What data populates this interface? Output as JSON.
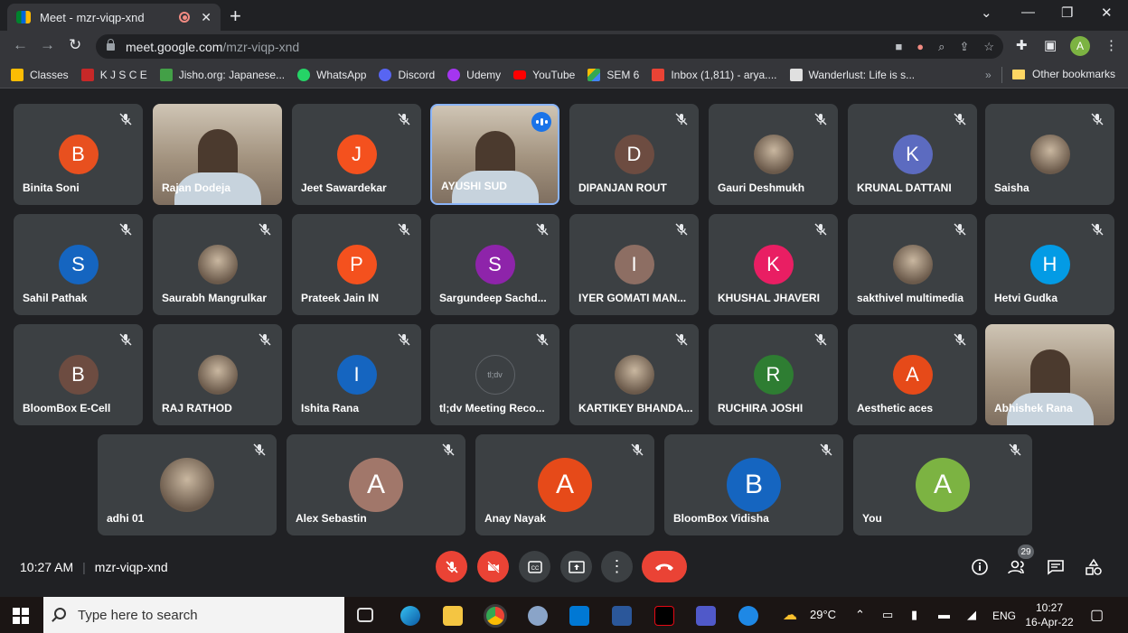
{
  "browser": {
    "tab_title": "Meet - mzr-viqp-xnd",
    "tab_close": "✕",
    "new_tab": "+",
    "url_host": "meet.google.com",
    "url_path": "/mzr-viqp-xnd",
    "profile_initial": "A"
  },
  "bookmarks": {
    "items": [
      "Classes",
      "K J S C E",
      "Jisho.org: Japanese...",
      "WhatsApp",
      "Discord",
      "Udemy",
      "YouTube",
      "SEM 6",
      "Inbox (1,811) - arya....",
      "Wanderlust: Life is s..."
    ],
    "more": "»",
    "other": "Other bookmarks"
  },
  "participants_row1": [
    {
      "name": "Binita Soni",
      "initial": "B",
      "color": "#e8501f"
    },
    {
      "name": "Rajan Dodeja",
      "video": true
    },
    {
      "name": "Jeet Sawardekar",
      "initial": "J",
      "color": "#f4511e"
    },
    {
      "name": "AYUSHI SUD",
      "video": true,
      "speaking": true
    },
    {
      "name": "DIPANJAN ROUT",
      "initial": "D",
      "color": "#6d4c41"
    },
    {
      "name": "Gauri Deshmukh",
      "photo": true
    },
    {
      "name": "KRUNAL DATTANI",
      "initial": "K",
      "color": "#5c6bc0"
    },
    {
      "name": "Saisha",
      "photo": true
    }
  ],
  "participants_row2": [
    {
      "name": "Sahil Pathak",
      "initial": "S",
      "color": "#1565c0"
    },
    {
      "name": "Saurabh Mangrulkar",
      "photo": true
    },
    {
      "name": "Prateek Jain IN",
      "initial": "P",
      "color": "#f4511e"
    },
    {
      "name": "Sargundeep Sachd...",
      "initial": "S",
      "color": "#8e24aa"
    },
    {
      "name": "IYER GOMATI MAN...",
      "initial": "I",
      "color": "#8d6e63"
    },
    {
      "name": "KHUSHAL JHAVERI",
      "initial": "K",
      "color": "#e91e63"
    },
    {
      "name": "sakthivel multimedia",
      "photo": true
    },
    {
      "name": "Hetvi Gudka",
      "initial": "H",
      "color": "#039be5"
    }
  ],
  "participants_row3": [
    {
      "name": "BloomBox E-Cell",
      "initial": "B",
      "color": "#6d4c41"
    },
    {
      "name": "RAJ RATHOD",
      "photo": true
    },
    {
      "name": "Ishita Rana",
      "initial": "I",
      "color": "#1565c0"
    },
    {
      "name": "tl;dv Meeting Reco...",
      "initial": "tl;dv",
      "color": "#3c4043"
    },
    {
      "name": "KARTIKEY BHANDA...",
      "photo": true
    },
    {
      "name": "RUCHIRA JOSHI",
      "initial": "R",
      "color": "#2e7d32"
    },
    {
      "name": "Aesthetic aces",
      "initial": "A",
      "color": "#e64a19"
    },
    {
      "name": "Abhishek Rana",
      "video": true
    }
  ],
  "participants_row4": [
    {
      "name": "adhi 01",
      "photo": true
    },
    {
      "name": "Alex Sebastin",
      "initial": "A",
      "color": "#a1776a"
    },
    {
      "name": "Anay Nayak",
      "initial": "A",
      "color": "#e64a19"
    },
    {
      "name": "BloomBox Vidisha",
      "initial": "B",
      "color": "#1565c0"
    },
    {
      "name": "You",
      "initial": "A",
      "color": "#7cb342"
    }
  ],
  "meeting": {
    "time": "10:27 AM",
    "separator": "|",
    "code": "mzr-viqp-xnd",
    "participant_count": "29"
  },
  "taskbar": {
    "search_placeholder": "Type here to search",
    "temperature": "29°C",
    "language": "ENG",
    "time": "10:27",
    "date": "16-Apr-22"
  }
}
